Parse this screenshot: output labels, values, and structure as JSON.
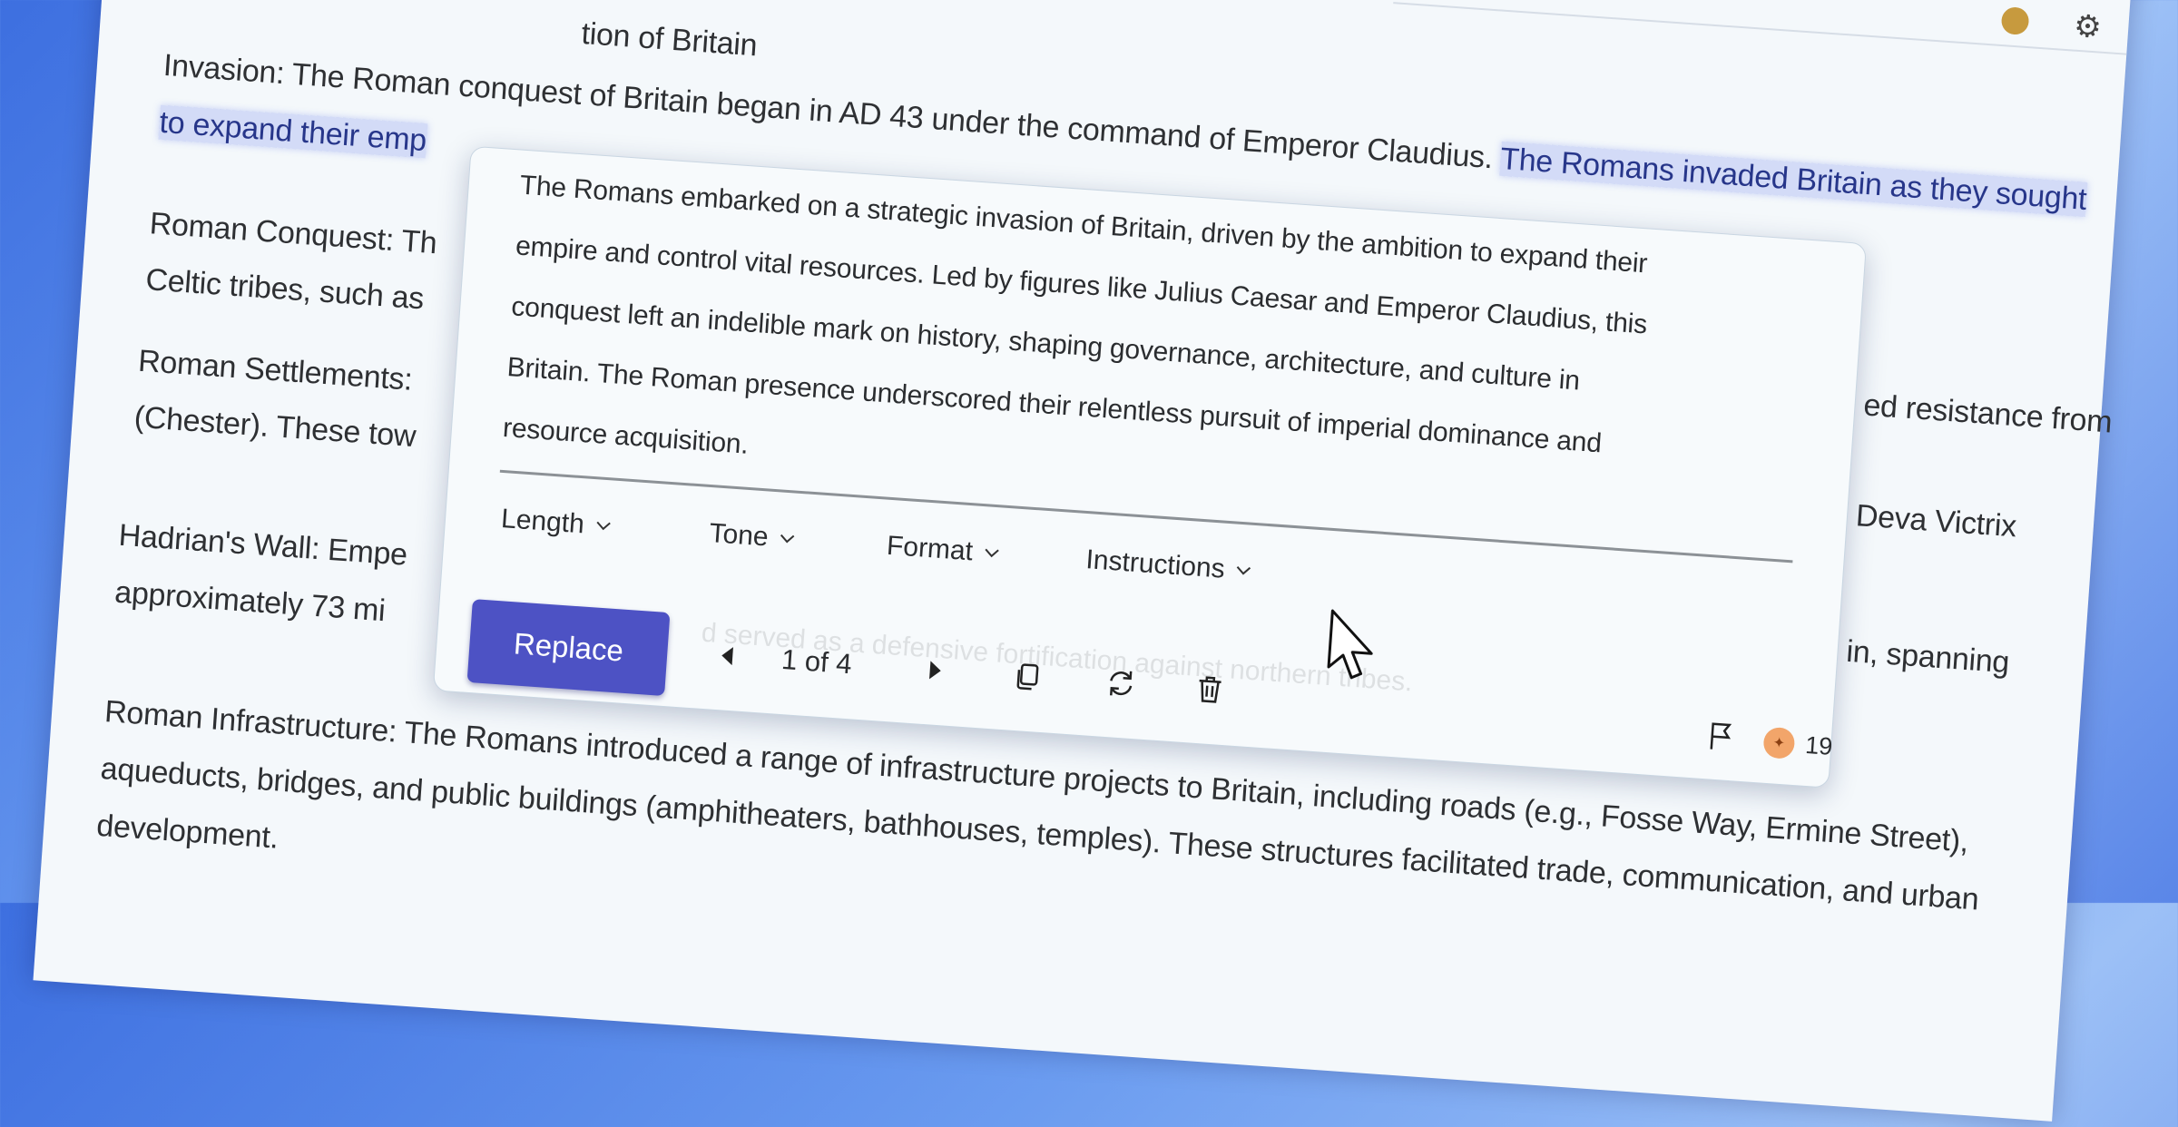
{
  "document": {
    "title_fragment": "tion of Britain",
    "lines_left": [
      {
        "text": "Invasion: The Roman conquest of Britain began in AD 43 under the command of Emperor Claudius. ",
        "highlight": "The Romans invaded Britain as they sought"
      },
      {
        "text": "",
        "highlight": "to expand their emp"
      },
      {
        "text": "Roman Conquest: Th",
        "highlight": ""
      },
      {
        "text": "Celtic tribes, such as",
        "highlight": ""
      },
      {
        "text": "Roman Settlements:",
        "highlight": ""
      },
      {
        "text": "(Chester). These tow",
        "highlight": ""
      },
      {
        "text": "Hadrian's Wall: Empe",
        "highlight": ""
      },
      {
        "text": "approximately 73 mi",
        "highlight": ""
      },
      {
        "text": "Roman Infrastructure: The Romans introduced a range of infrastructure projects to Britain, including roads (e.g., Fosse Way, Ermine Street),",
        "highlight": ""
      },
      {
        "text": "aqueducts, bridges, and public buildings (amphitheaters, bathhouses, temples). These structures facilitated trade, communication, and urban",
        "highlight": ""
      },
      {
        "text": "development.",
        "highlight": ""
      }
    ],
    "right_fragments": [
      "ed resistance from",
      "Deva Victrix",
      "in, spanning"
    ],
    "behind_popup_fragment": "d served as a defensive fortification against northern tribes."
  },
  "popup": {
    "rewrite_lines": [
      "The Romans embarked on a strategic invasion of Britain, driven by the ambition to expand their",
      "empire and control vital resources. Led by figures like Julius Caesar and Emperor Claudius, this",
      "conquest left an indelible mark on history, shaping governance, architecture, and culture in",
      "Britain. The Roman presence underscored their relentless pursuit of imperial dominance and",
      "resource acquisition."
    ],
    "dropdowns": [
      "Length",
      "Tone",
      "Format",
      "Instructions"
    ],
    "replace_label": "Replace",
    "counter": "1 of 4",
    "credits": "19"
  },
  "colors": {
    "accent": "#4d52c4",
    "highlight": "#27368a",
    "credit_coin": "#f2a56a"
  },
  "icons": [
    "settings-gear-icon",
    "avatar",
    "chevron-down-icon",
    "prev-icon",
    "next-icon",
    "copy-icon",
    "regenerate-icon",
    "delete-icon",
    "flag-icon",
    "credits-icon",
    "mouse-cursor-icon"
  ]
}
